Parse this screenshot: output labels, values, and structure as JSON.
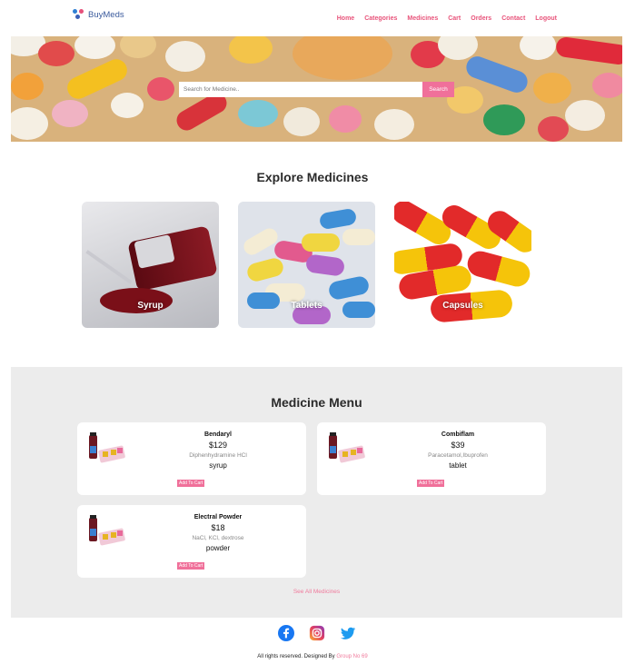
{
  "brand": {
    "name": "BuyMeds"
  },
  "nav": [
    "Home",
    "Categories",
    "Medicines",
    "Cart",
    "Orders",
    "Contact",
    "Logout"
  ],
  "search": {
    "placeholder": "Search for Medicine..",
    "button": "Search"
  },
  "explore": {
    "title": "Explore Medicines",
    "categories": [
      "Syrup",
      "Tablets",
      "Capsules"
    ]
  },
  "menu": {
    "title": "Medicine Menu",
    "items": [
      {
        "name": "Bendaryl",
        "price": "$129",
        "ingredients": "Diphenhydramine HCl",
        "type": "syrup",
        "button": "Add To Cart"
      },
      {
        "name": "Combiflam",
        "price": "$39",
        "ingredients": "Paracetamol,Ibuprofen",
        "type": "tablet",
        "button": "Add To Cart"
      },
      {
        "name": "Electral Powder",
        "price": "$18",
        "ingredients": "NaCl, KCl, dextrose",
        "type": "powder",
        "button": "Add To Cart"
      }
    ],
    "see_all": "See All Medicines"
  },
  "footer": {
    "socials": [
      "facebook-icon",
      "instagram-icon",
      "twitter-icon"
    ],
    "copyright": "All rights reserved. Designed By",
    "group": "Group No 69"
  },
  "colors": {
    "accent": "#f0709a",
    "brand_blue": "#3a5a9c"
  }
}
